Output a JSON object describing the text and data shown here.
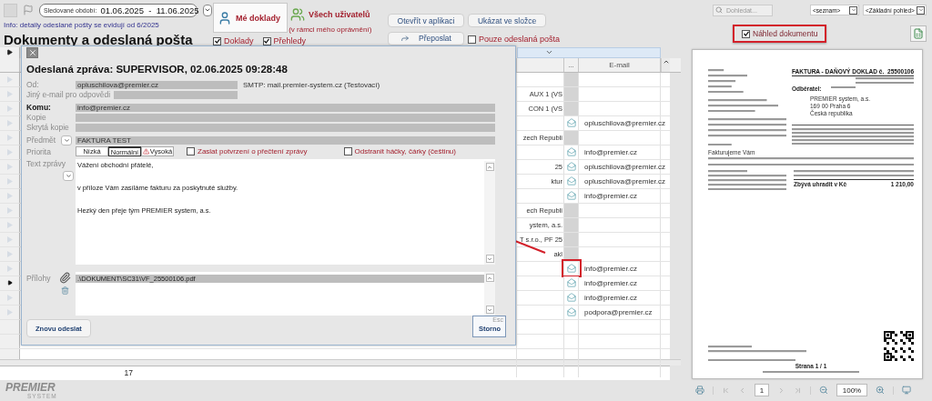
{
  "toolbar": {
    "period_label": "Sledované období:",
    "period": "01.06.2025  -  11.06.2025",
    "info": "Info: detaily odeslané pošty se evidují od 6/2025",
    "title": "Dokumenty a odeslaná pošta"
  },
  "view_tabs": [
    {
      "label": "Mé doklady",
      "selected": true,
      "kind": "single"
    },
    {
      "label": "Všech uživatelů",
      "selected": false,
      "kind": "group",
      "note": "(v rámci mého oprávnění)"
    }
  ],
  "filters": [
    {
      "label": "Doklady",
      "checked": true
    },
    {
      "label": "Přehledy",
      "checked": true
    }
  ],
  "actions": [
    {
      "label": "Otevřít v aplikaci",
      "kind": "plain"
    },
    {
      "label": "Ukázat ve složce",
      "kind": "plain"
    },
    {
      "label": "Přeposlat",
      "kind": "forward"
    }
  ],
  "sent_only": {
    "label": "Pouze odeslaná pošta",
    "checked": false
  },
  "search": {
    "placeholder": "Dohledat..."
  },
  "list_select": {
    "value": "<seznam>"
  },
  "view_select": {
    "value": "<Základní pohled>"
  },
  "preview_toggle": {
    "label": "Náhled dokumentu",
    "checked": true,
    "highlighted": true
  },
  "table": {
    "columns": [
      "...",
      "E-mail"
    ],
    "count": "17",
    "rows": [
      {
        "envelope": false,
        "selected": false
      },
      {
        "fragment": "AUX 1  (VS",
        "envelope": false,
        "selected": false
      },
      {
        "fragment": "CON 1  (VS",
        "envelope": false,
        "selected": false
      },
      {
        "envelope": true,
        "email": "opluschilova@premier.cz",
        "selected": false
      },
      {
        "fragment": "zech Republi",
        "envelope": false,
        "selected": false
      },
      {
        "envelope": true,
        "email": "info@premier.cz",
        "selected": false
      },
      {
        "fragment": "25",
        "envelope": true,
        "email": "opluschilova@premier.cz",
        "selected": false
      },
      {
        "fragment": "ktur",
        "envelope": true,
        "email": "opluschilova@premier.cz",
        "selected": false
      },
      {
        "envelope": true,
        "email": "info@premier.cz",
        "selected": false
      },
      {
        "fragment": "ech Republi",
        "envelope": false,
        "selected": false
      },
      {
        "fragment": "ystem, a.s.",
        "envelope": false,
        "selected": false
      },
      {
        "fragment": "T s.r.o., PF 25",
        "envelope": false,
        "selected": false
      },
      {
        "fragment": "akl",
        "envelope": false,
        "selected": false
      },
      {
        "envelope": true,
        "email": "info@premier.cz",
        "selected": false,
        "highlighted": true
      },
      {
        "envelope": true,
        "email": "info@premier.cz",
        "selected": true
      },
      {
        "envelope": true,
        "email": "info@premier.cz",
        "selected": false
      },
      {
        "envelope": true,
        "email": "podpora@premier.cz",
        "selected": false
      }
    ]
  },
  "dialog": {
    "title": "Odeslaná zpráva: SUPERVISOR, 02.06.2025 09:28:48",
    "fields": [
      {
        "label": "Od:",
        "value": "opluschilova@premier.cz",
        "note": "SMTP: mail.premier-system.cz (Testovací)",
        "kind": "short",
        "bold": false
      },
      {
        "label": "Jiný e-mail pro odpovědi",
        "kind": "short",
        "bold": false
      },
      {
        "label": "Komu:",
        "value": "info@premier.cz",
        "kind": "wide",
        "bold": true
      },
      {
        "label": "Kopie",
        "kind": "wide",
        "bold": false
      },
      {
        "label": "Skrytá kopie",
        "kind": "wide",
        "bold": false
      },
      {
        "label": "Předmět",
        "value": "FAKTURA TEST",
        "kind": "wide",
        "bold": false,
        "dropdown": true
      }
    ],
    "priority": {
      "label": "Priorita",
      "options": [
        {
          "label": "Nízká",
          "selected": false,
          "kind": "plain"
        },
        {
          "label": "Normální",
          "selected": true,
          "kind": "plain"
        },
        {
          "label": "Vysoká",
          "selected": false,
          "kind": "urgent"
        }
      ]
    },
    "options": [
      {
        "label": "Zaslat potvrzení o přečtení zprávy",
        "checked": false
      },
      {
        "label": "Odstranit háčky, čárky (češtinu)",
        "checked": false
      }
    ],
    "body": {
      "label": "Text zprávy",
      "lines": [
        "Vážení obchodní přátelé,",
        "v příloze Vám zasíláme fakturu za poskytnuté služby.",
        "Hezký den přeje tým PREMIER system, a.s."
      ]
    },
    "attachments": {
      "label": "Přílohy",
      "files": [
        {
          "name": ".\\DOKUMENT\\SC31\\VF_25500106.pdf",
          "selected": true
        }
      ]
    },
    "resend": "Znovu odeslat",
    "cancel": {
      "label": "Storno",
      "shortcut": "Esc"
    }
  },
  "preview": {
    "document": {
      "title": "FAKTURA - DAŇOVÝ DOKLAD č.",
      "number": "25500106",
      "buyer_label": "Odběratel:",
      "buyer_lines": [
        "PREMIER system, a.s.",
        "169 00   Praha 6",
        "Česká republika"
      ],
      "intro": "Fakturujeme Vám",
      "total_label": "Zbývá uhradit v Kč",
      "total_value": "1 210,00",
      "page": "Strana 1 / 1"
    },
    "page_number": "1",
    "zoom": "100%"
  },
  "logo": {
    "name": "PREMIER",
    "tagline": "SYSTEM"
  }
}
